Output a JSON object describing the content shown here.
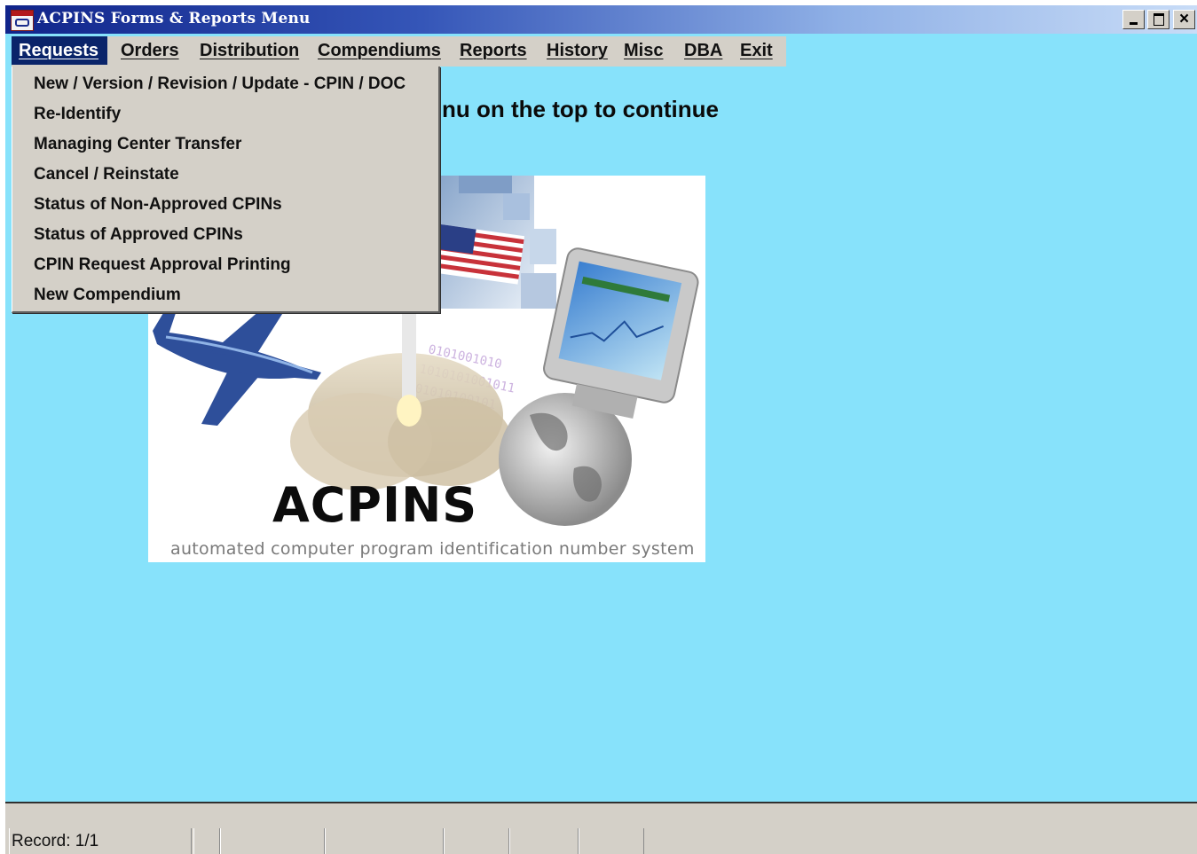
{
  "window": {
    "title": "ACPINS Forms & Reports Menu",
    "controls": {
      "minimize": "minimize",
      "maximize": "maximize",
      "close": "×"
    }
  },
  "menubar": {
    "items": [
      {
        "label": "Requests",
        "active": true
      },
      {
        "label": "Orders"
      },
      {
        "label": "Distribution"
      },
      {
        "label": "Compendiums"
      },
      {
        "label": "Reports"
      },
      {
        "label": "History"
      },
      {
        "label": "Misc"
      },
      {
        "label": "DBA"
      },
      {
        "label": "Exit"
      }
    ]
  },
  "dropdown": {
    "items": [
      "New / Version / Revision / Update - CPIN / DOC",
      "Re-Identify",
      "Managing Center Transfer",
      "Cancel / Reinstate",
      "Status of Non-Approved CPINs",
      "Status of Approved CPINs",
      "CPIN Request Approval Printing",
      "New Compendium"
    ]
  },
  "main": {
    "message": "nu on the top to continue",
    "logo": {
      "title": "ACPINS",
      "subtitle": "automated computer program identification number system"
    }
  },
  "statusbar": {
    "record": "Record: 1/1"
  },
  "colors": {
    "workspace": "#87e2fb",
    "titlebar_start": "#10248a",
    "menu_highlight": "#0a246a",
    "chrome": "#d4d0c8"
  }
}
